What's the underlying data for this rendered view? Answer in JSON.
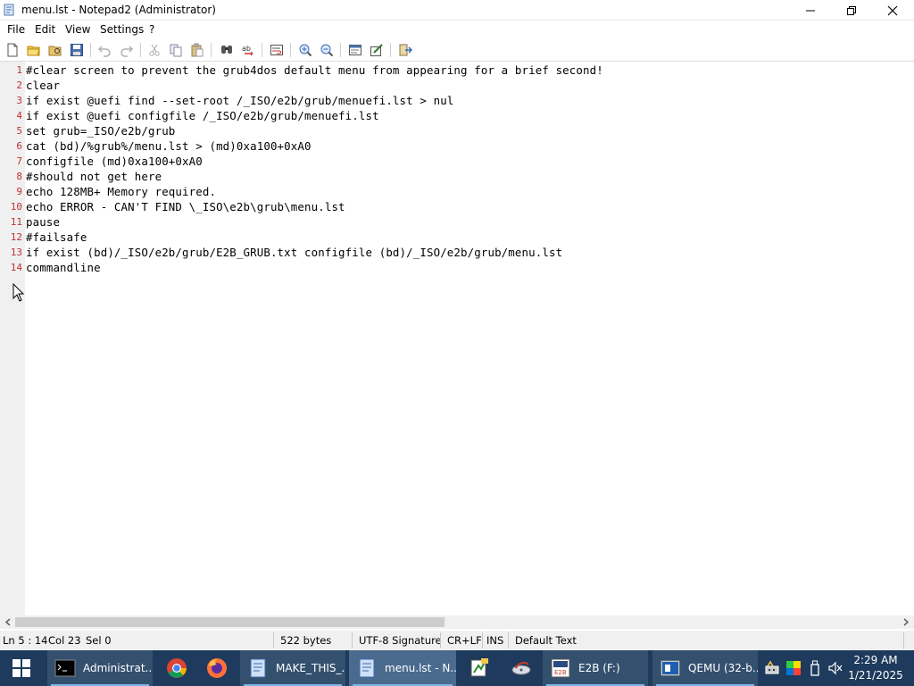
{
  "window": {
    "title": "menu.lst - Notepad2 (Administrator)"
  },
  "menu": [
    "File",
    "Edit",
    "View",
    "Settings",
    "?"
  ],
  "toolbar_icons": [
    "new-icon",
    "open-icon",
    "browse-icon",
    "save-icon",
    "undo-icon",
    "redo-icon",
    "cut-icon",
    "copy-icon",
    "paste-icon",
    "find-icon",
    "replace-icon",
    "word-wrap-icon",
    "zoom-in-icon",
    "zoom-out-icon",
    "scheme-icon",
    "customize-icon",
    "exit-icon"
  ],
  "editor": {
    "lines": [
      {
        "n": "1",
        "text": "#clear screen to prevent the grub4dos default menu from appearing for a brief second!"
      },
      {
        "n": "2",
        "text": "clear"
      },
      {
        "n": "3",
        "text": "if exist @uefi find --set-root /_ISO/e2b/grub/menuefi.lst > nul"
      },
      {
        "n": "4",
        "text": "if exist @uefi configfile /_ISO/e2b/grub/menuefi.lst"
      },
      {
        "n": "5",
        "text": "set grub=_ISO/e2b/grub"
      },
      {
        "n": "6",
        "text": "cat (bd)/%grub%/menu.lst > (md)0xa100+0xA0"
      },
      {
        "n": "7",
        "text": "configfile (md)0xa100+0xA0"
      },
      {
        "n": "8",
        "text": "#should not get here"
      },
      {
        "n": "9",
        "text": "echo 128MB+ Memory required."
      },
      {
        "n": "10",
        "text": "echo ERROR - CAN'T FIND \\_ISO\\e2b\\grub\\menu.lst"
      },
      {
        "n": "11",
        "text": "pause"
      },
      {
        "n": "12",
        "text": "#failsafe"
      },
      {
        "n": "13",
        "text": "if exist (bd)/_ISO/e2b/grub/E2B_GRUB.txt configfile (bd)/_ISO/e2b/grub/menu.lst"
      },
      {
        "n": "14",
        "text": "commandline"
      }
    ]
  },
  "statusbar": {
    "position": "Ln 5 : 14",
    "column": "Col 23",
    "selection": "Sel 0",
    "size": "522 bytes",
    "encoding": "UTF-8 Signature",
    "line_endings": "CR+LF",
    "mode": "INS",
    "scheme": "Default Text"
  },
  "taskbar": {
    "tasks": [
      {
        "label": "Administrat...",
        "icon": "cmd-icon",
        "state": "open"
      },
      {
        "label": "",
        "icon": "chrome-icon",
        "state": "pinned"
      },
      {
        "label": "",
        "icon": "firefox-icon",
        "state": "pinned"
      },
      {
        "label": "MAKE_THIS_...",
        "icon": "notepad2-icon",
        "state": "open"
      },
      {
        "label": "menu.lst - N...",
        "icon": "notepad2-icon",
        "state": "active"
      },
      {
        "label": "",
        "icon": "script-icon",
        "state": "pinned"
      },
      {
        "label": "",
        "icon": "disk-tool-icon",
        "state": "pinned"
      },
      {
        "label": "E2B (F:)",
        "icon": "e2b-icon",
        "state": "open"
      },
      {
        "label": "QEMU (32-b...",
        "icon": "qemu-icon",
        "state": "open"
      }
    ],
    "tray_icons": [
      "network-tool-icon",
      "color-icon",
      "usb-icon",
      "mute-icon"
    ],
    "clock": {
      "time": "2:29 AM",
      "date": "1/21/2025"
    }
  },
  "colors": {
    "line_number": "#c03030",
    "taskbar": "#1e3a5c",
    "taskbar_active": "#4a6a8e"
  }
}
